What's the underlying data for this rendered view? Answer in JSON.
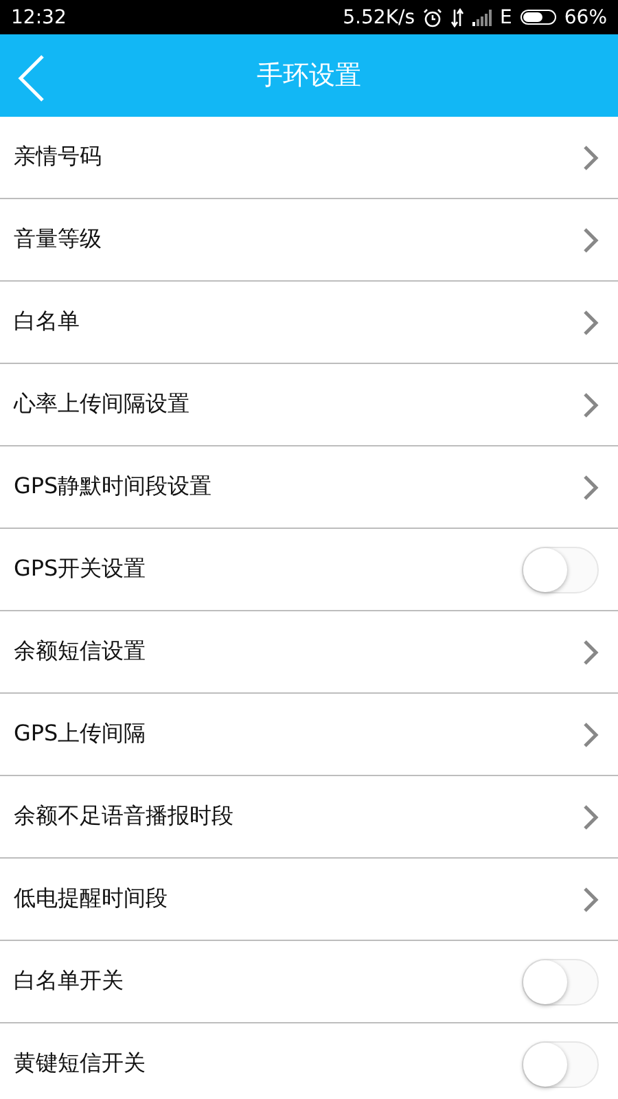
{
  "status_bar": {
    "time": "12:32",
    "speed": "5.52K/s",
    "network": "E",
    "battery": "66%"
  },
  "header": {
    "title": "手环设置"
  },
  "items": [
    {
      "kind": "link",
      "label": "亲情号码"
    },
    {
      "kind": "link",
      "label": "音量等级"
    },
    {
      "kind": "link",
      "label": "白名单"
    },
    {
      "kind": "link",
      "label": "心率上传间隔设置"
    },
    {
      "kind": "link",
      "label": "GPS静默时间段设置"
    },
    {
      "kind": "switch",
      "label": "GPS开关设置",
      "on": false
    },
    {
      "kind": "link",
      "label": "余额短信设置"
    },
    {
      "kind": "link",
      "label": "GPS上传间隔"
    },
    {
      "kind": "link",
      "label": "余额不足语音播报时段"
    },
    {
      "kind": "link",
      "label": "低电提醒时间段"
    },
    {
      "kind": "switch",
      "label": "白名单开关",
      "on": false
    },
    {
      "kind": "switch",
      "label": "黄键短信开关",
      "on": false
    }
  ]
}
